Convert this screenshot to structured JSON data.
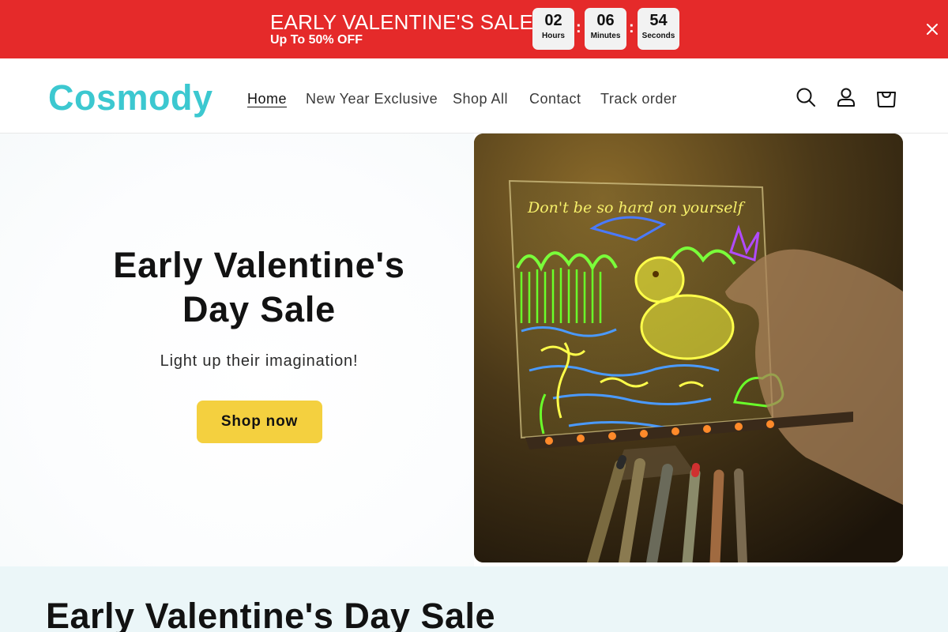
{
  "announcement": {
    "title": "EARLY VALENTINE'S SALE",
    "subtitle": "Up To 50% OFF",
    "timer": [
      {
        "value": "02",
        "unit": "Hours"
      },
      {
        "value": "06",
        "unit": "Minutes"
      },
      {
        "value": "54",
        "unit": "Seconds"
      }
    ],
    "separator": ":",
    "close_icon": "close-icon",
    "background_color": "#e52a2a"
  },
  "header": {
    "logo": "Cosmody",
    "logo_color": "#3cc8d0",
    "nav": [
      {
        "label": "Home",
        "active": true
      },
      {
        "label": "New Year Exclusive",
        "active": false
      },
      {
        "label": "Shop All",
        "active": false
      },
      {
        "label": "Contact",
        "active": false
      },
      {
        "label": "Track order",
        "active": false
      }
    ],
    "icons": [
      "search-icon",
      "account-icon",
      "cart-icon"
    ]
  },
  "hero": {
    "title": "Early Valentine's Day Sale",
    "subtitle": "Light up their imagination!",
    "button_label": "Shop now",
    "button_color": "#f4d03f",
    "image_text": "Don't be so hard on yourself"
  },
  "section": {
    "title": "Early Valentine's Day Sale",
    "background_color": "#ebf6f8"
  }
}
